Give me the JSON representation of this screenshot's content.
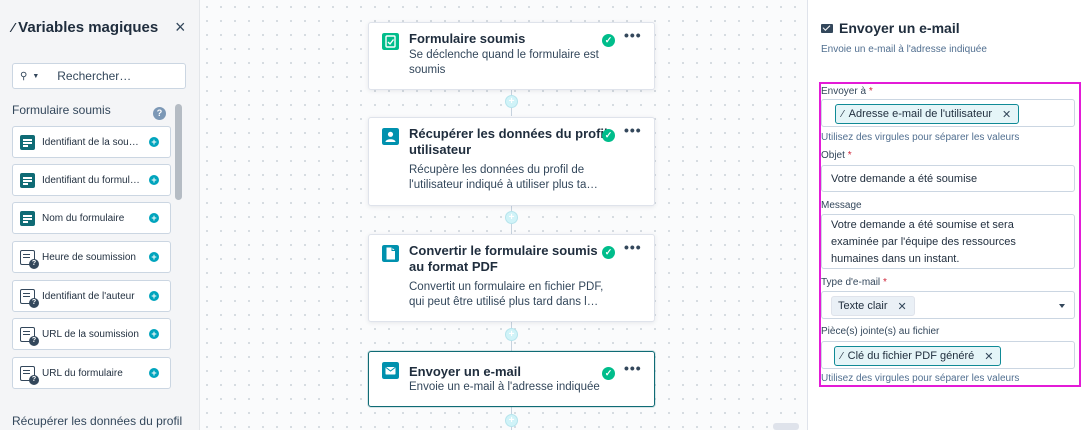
{
  "magic_panel": {
    "title": "Variables magiques",
    "search_placeholder": "Rechercher…",
    "section_title": "Formulaire soumis",
    "help_glyph": "?",
    "items": [
      {
        "label": "Identifiant de la soumission",
        "icon": "text-field-icon"
      },
      {
        "label": "Identifiant du formulaire",
        "icon": "text-field-icon"
      },
      {
        "label": "Nom du formulaire",
        "icon": "text-field-icon"
      },
      {
        "label": "Heure de soumission",
        "icon": "unknown-field-icon"
      },
      {
        "label": "Identifiant de l'auteur",
        "icon": "unknown-field-icon"
      },
      {
        "label": "URL de la soumission",
        "icon": "unknown-field-icon"
      },
      {
        "label": "URL du formulaire",
        "icon": "unknown-field-icon"
      }
    ],
    "next_section_title": "Récupérer les données du profil"
  },
  "workflow": {
    "steps": [
      {
        "title": "Formulaire soumis",
        "description": "Se déclenche quand le formulaire est soumis",
        "icon": "form-check-icon",
        "icon_color": "#00bd8b"
      },
      {
        "title": "Récupérer les données du profil utilisateur",
        "description": "Récupère les données du profil de l'utilisateur indiqué à utiliser plus ta…",
        "icon": "user-profile-icon",
        "icon_color": "#0091ae"
      },
      {
        "title": "Convertir le formulaire soumis au format PDF",
        "description": "Convertit un formulaire en fichier PDF, qui peut être utilisé plus tard dans l…",
        "icon": "document-icon",
        "icon_color": "#0091ae"
      },
      {
        "title": "Envoyer un e-mail",
        "description": "Envoie un e-mail à l'adresse indiquée",
        "icon": "email-icon",
        "icon_color": "#0091ae"
      }
    ],
    "more_glyph": "•••",
    "check_glyph": "✓",
    "plus_glyph": "+"
  },
  "action_panel": {
    "title": "Envoyer un e-mail",
    "subtitle": "Envoie un e-mail à l'adresse indiquée",
    "send_to": {
      "label": "Envoyer à",
      "required_mark": "*",
      "chip": "Adresse e-mail de l'utilisateur",
      "help": "Utilisez des virgules pour séparer les valeurs"
    },
    "subject": {
      "label": "Objet",
      "required_mark": "*",
      "value": "Votre demande a été soumise"
    },
    "message": {
      "label": "Message",
      "value": "Votre demande a été soumise et sera examinée par l'équipe des ressources humaines dans un instant."
    },
    "email_type": {
      "label": "Type d'e-mail",
      "required_mark": "*",
      "value": "Texte clair"
    },
    "attachments": {
      "label": "Pièce(s) jointe(s) au fichier",
      "chip": "Clé du fichier PDF généré",
      "help": "Utilisez des virgules pour séparer les valeurs"
    }
  },
  "colors": {
    "accent": "#0f6b75",
    "highlight": "#e31bd7",
    "success": "#00bd8b",
    "add": "#00a4bd"
  }
}
